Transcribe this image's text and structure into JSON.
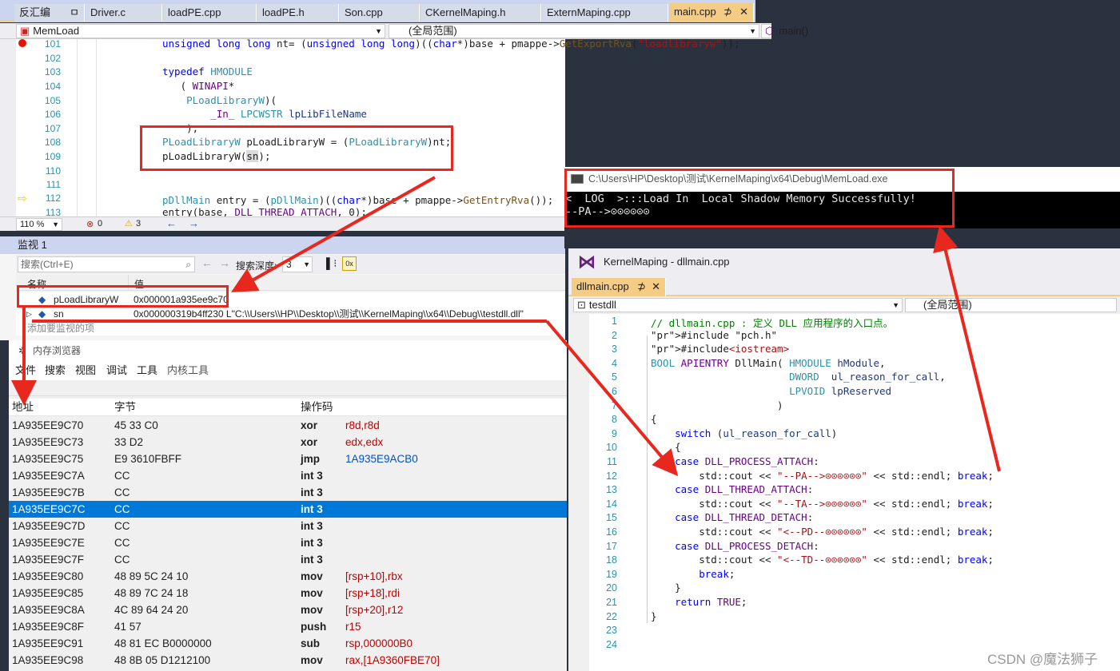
{
  "tabs": [
    {
      "label": "反汇编",
      "pin": "ㅁ"
    },
    {
      "label": "Driver.c"
    },
    {
      "label": "loadPE.cpp"
    },
    {
      "label": "loadPE.h"
    },
    {
      "label": "Son.cpp"
    },
    {
      "label": "CKernelMaping.h"
    },
    {
      "label": "ExternMaping.cpp"
    },
    {
      "label": "main.cpp",
      "pin": "⊅",
      "close": "✕"
    }
  ],
  "nav": {
    "project": "MemLoad",
    "scope": "(全局范围)",
    "func": "main()"
  },
  "editor": {
    "lines": [
      {
        "n": "101",
        "text": "unsigned long long nt= (unsigned long long)((char*)base + pmappe->GetExportRva(\"loadlibraryw\"));"
      },
      {
        "n": "102",
        "text": ""
      },
      {
        "n": "103",
        "text": "typedef HMODULE"
      },
      {
        "n": "104",
        "text": "   ( WINAPI*"
      },
      {
        "n": "105",
        "text": "    PLoadLibraryW)("
      },
      {
        "n": "106",
        "text": "        _In_ LPCWSTR lpLibFileName"
      },
      {
        "n": "107",
        "text": "    );"
      },
      {
        "n": "108",
        "text": "PLoadLibraryW pLoadLibraryW = (PLoadLibraryW)nt;"
      },
      {
        "n": "109",
        "text": "pLoadLibraryW(sn);"
      },
      {
        "n": "110",
        "text": ""
      },
      {
        "n": "111",
        "text": ""
      },
      {
        "n": "112",
        "text": "pDllMain entry = (pDllMain)((char*)base + pmappe->GetEntryRva());  已用"
      },
      {
        "n": "113",
        "text": "entry(base, DLL_THREAD_ATTACH, 0);"
      }
    ],
    "zoom": "110 %",
    "errors": "0",
    "warnings": "3"
  },
  "watch": {
    "title": "监视 1",
    "search_placeholder": "搜索(Ctrl+E)",
    "depth_label": "搜索深度:",
    "depth_value": "3",
    "col_name": "名称",
    "col_value": "值",
    "rows": [
      {
        "name": "pLoadLibraryW",
        "value": "0x000001a935ee9c70"
      },
      {
        "name": "sn",
        "value": "0x000000319b4ff230 L\"C:\\\\Users\\\\HP\\\\Desktop\\\\测试\\\\KernelMaping\\\\x64\\\\Debug\\\\testdll.dll\""
      }
    ],
    "add_hint": "添加要监视的项"
  },
  "memory": {
    "title": "内存浏览器",
    "menu": [
      "文件",
      "搜索",
      "视图",
      "调试",
      "工具",
      "内核工具"
    ],
    "col_addr": "地址",
    "col_bytes": "字节",
    "col_op": "操作码",
    "rows": [
      {
        "addr": "1A935EE9C70",
        "bytes": "45 33 C0",
        "op": "xor",
        "args": "r8d,r8d"
      },
      {
        "addr": "1A935EE9C73",
        "bytes": "33 D2",
        "op": "xor",
        "args": "edx,edx"
      },
      {
        "addr": "1A935EE9C75",
        "bytes": "E9 3610FBFF",
        "op": "jmp",
        "args": "1A935E9ACB0",
        "blue": true
      },
      {
        "addr": "1A935EE9C7A",
        "bytes": "CC",
        "op": "int 3",
        "args": ""
      },
      {
        "addr": "1A935EE9C7B",
        "bytes": "CC",
        "op": "int 3",
        "args": ""
      },
      {
        "addr": "1A935EE9C7C",
        "bytes": "CC",
        "op": "int 3",
        "args": "",
        "selected": true
      },
      {
        "addr": "1A935EE9C7D",
        "bytes": "CC",
        "op": "int 3",
        "args": ""
      },
      {
        "addr": "1A935EE9C7E",
        "bytes": "CC",
        "op": "int 3",
        "args": ""
      },
      {
        "addr": "1A935EE9C7F",
        "bytes": "CC",
        "op": "int 3",
        "args": ""
      },
      {
        "addr": "1A935EE9C80",
        "bytes": "48 89 5C 24 10",
        "op": "mov",
        "args": "[rsp+10],rbx"
      },
      {
        "addr": "1A935EE9C85",
        "bytes": "48 89 7C 24 18",
        "op": "mov",
        "args": "[rsp+18],rdi"
      },
      {
        "addr": "1A935EE9C8A",
        "bytes": "4C 89 64 24 20",
        "op": "mov",
        "args": "[rsp+20],r12"
      },
      {
        "addr": "1A935EE9C8F",
        "bytes": "41 57",
        "op": "push",
        "args": "r15"
      },
      {
        "addr": "1A935EE9C91",
        "bytes": "48 81 EC B0000000",
        "op": "sub",
        "args": "rsp,000000B0"
      },
      {
        "addr": "1A935EE9C98",
        "bytes": "48 8B 05 D1212100",
        "op": "mov",
        "args": "rax,[1A9360FBE70]"
      }
    ]
  },
  "console": {
    "title": "C:\\Users\\HP\\Desktop\\测试\\KernelMaping\\x64\\Debug\\MemLoad.exe",
    "lines": [
      "<  LOG  >:::Load In  Local Shadow Memory Successfully!",
      "--PA-->⊙⊙⊙⊙⊙⊙"
    ]
  },
  "vs2": {
    "title": "KernelMaping - dllmain.cpp",
    "tab": "dllmain.cpp",
    "project": "testdll",
    "scope": "(全局范围)",
    "lines": [
      {
        "n": "1",
        "text": "// dllmain.cpp : 定义 DLL 应用程序的入口点。"
      },
      {
        "n": "2",
        "text": "#include \"pch.h\""
      },
      {
        "n": "3",
        "text": "#include<iostream>"
      },
      {
        "n": "4",
        "text": "BOOL APIENTRY DllMain( HMODULE hModule,"
      },
      {
        "n": "5",
        "text": "                       DWORD  ul_reason_for_call,"
      },
      {
        "n": "6",
        "text": "                       LPVOID lpReserved"
      },
      {
        "n": "7",
        "text": "                     )"
      },
      {
        "n": "8",
        "text": "{"
      },
      {
        "n": "9",
        "text": "    switch (ul_reason_for_call)"
      },
      {
        "n": "10",
        "text": "    {"
      },
      {
        "n": "11",
        "text": "    case DLL_PROCESS_ATTACH:"
      },
      {
        "n": "12",
        "text": "        std::cout << \"--PA-->⊙⊙⊙⊙⊙⊙\" << std::endl; break;"
      },
      {
        "n": "13",
        "text": "    case DLL_THREAD_ATTACH:"
      },
      {
        "n": "14",
        "text": "        std::cout << \"--TA-->⊙⊙⊙⊙⊙⊙\" << std::endl; break;"
      },
      {
        "n": "15",
        "text": "    case DLL_THREAD_DETACH:"
      },
      {
        "n": "16",
        "text": "        std::cout << \"<--PD--⊙⊙⊙⊙⊙⊙\" << std::endl; break;"
      },
      {
        "n": "17",
        "text": "    case DLL_PROCESS_DETACH:"
      },
      {
        "n": "18",
        "text": "        std::cout << \"<--TD--⊙⊙⊙⊙⊙⊙\" << std::endl; break;"
      },
      {
        "n": "19",
        "text": "        break;"
      },
      {
        "n": "20",
        "text": "    }"
      },
      {
        "n": "21",
        "text": "    return TRUE;"
      },
      {
        "n": "22",
        "text": "}"
      },
      {
        "n": "23",
        "text": ""
      },
      {
        "n": "24",
        "text": ""
      }
    ]
  },
  "watermark": "CSDN @魔法狮子",
  "colors": {
    "annotation": "#e8271f",
    "selection": "#0078d7",
    "tab_active": "#f5cc84"
  }
}
